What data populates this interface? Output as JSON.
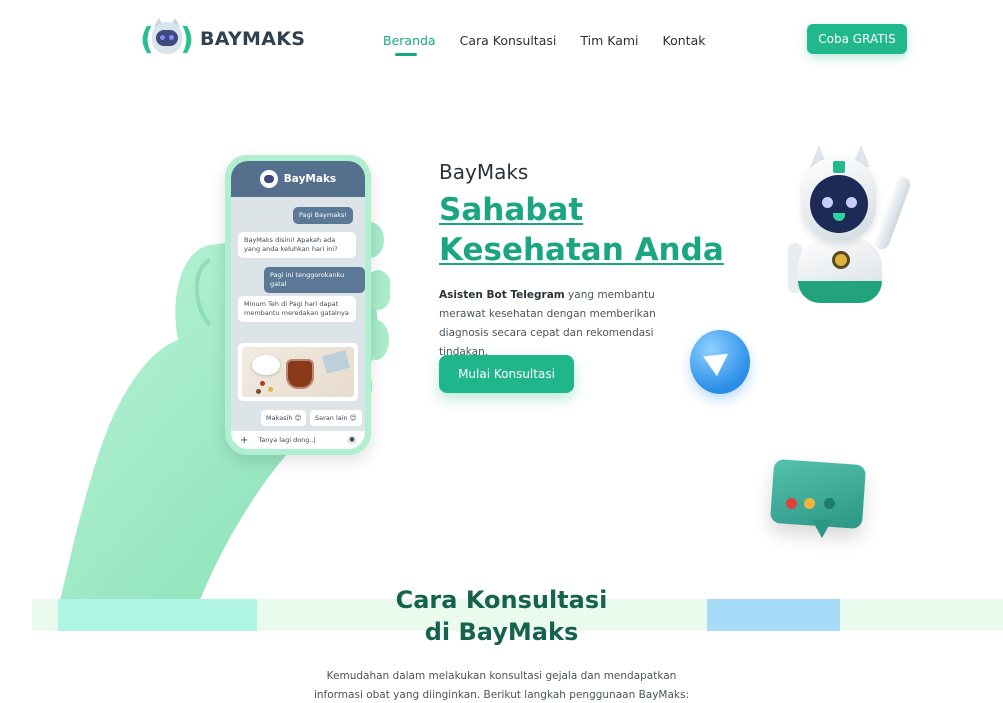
{
  "brand": {
    "logo_text": "BAYMAKS"
  },
  "nav": {
    "items": [
      {
        "label": "Beranda",
        "active": true
      },
      {
        "label": "Cara Konsultasi",
        "active": false
      },
      {
        "label": "Tim Kami",
        "active": false
      },
      {
        "label": "Kontak",
        "active": false
      }
    ]
  },
  "header": {
    "cta_label": "Coba GRATIS"
  },
  "phone": {
    "chat_title": "BayMaks",
    "messages": [
      "Pagi Baymaks!",
      "BayMaks disini! Apakah ada yang anda keluhkan hari ini?",
      "Pagi ini tenggorokanku gatal",
      "Minum Teh di Pagi hari dapat membantu meredakan gatalnya"
    ],
    "chips": [
      "Makasih 😊",
      "Saran lain 😊"
    ],
    "input_placeholder": "Tanya lagi dong..|"
  },
  "hero": {
    "brand": "BayMaks",
    "title_line1": "Sahabat",
    "title_line2": "Kesehatan Anda",
    "desc_bold": "Asisten Bot Telegram",
    "desc_rest": " yang membantu merawat kesehatan dengan memberikan diagnosis secara cepat dan rekomendasi tindakan.",
    "cta_label": "Mulai Konsultasi"
  },
  "section": {
    "title_line1": "Cara Konsultasi",
    "title_line2": "di BayMaks",
    "desc_line1": "Kemudahan dalam melakukan konsultasi gejala dan mendapatkan",
    "desc_line2": "informasi obat yang diinginkan. Berikut langkah penggunaan BayMaks:"
  },
  "colors": {
    "accent": "#1fb68b",
    "title_green": "#1aa583",
    "dark_green": "#16634d",
    "chat_header": "#55708d"
  },
  "icons": [
    "robot-logo-icon",
    "telegram-icon",
    "chat-bubble-icon",
    "plus-icon",
    "mic-icon"
  ]
}
